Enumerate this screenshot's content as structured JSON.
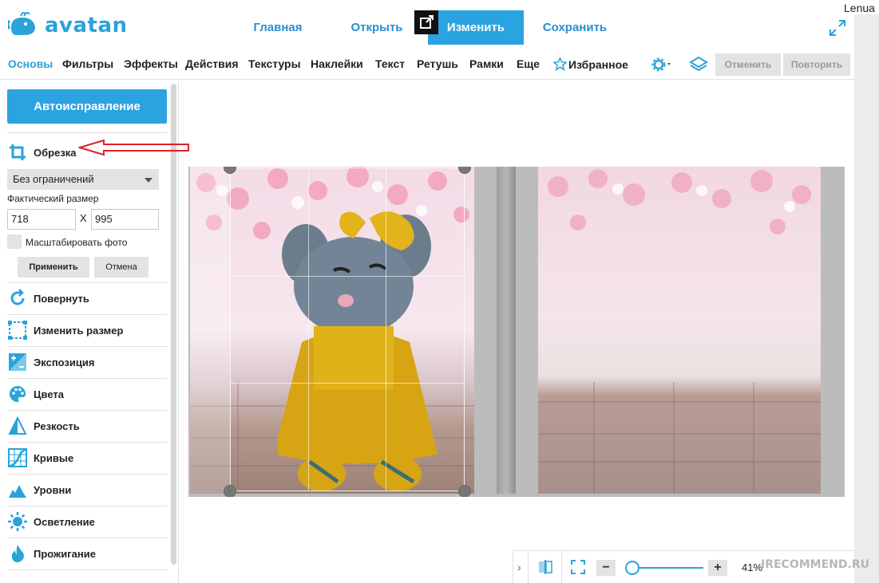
{
  "app": {
    "logo_text": "avatan",
    "user": "Lenua"
  },
  "topnav": {
    "home": "Главная",
    "open": "Открыть",
    "edit": "Изменить",
    "save": "Сохранить"
  },
  "tabs": {
    "items": [
      "Основы",
      "Фильтры",
      "Эффекты",
      "Действия",
      "Текстуры",
      "Наклейки",
      "Текст",
      "Ретушь",
      "Рамки",
      "Еще",
      "Избранное"
    ],
    "active": "Основы",
    "undo": "Отменить",
    "redo": "Повторить"
  },
  "sidebar": {
    "autofix": "Автоисправление",
    "crop": {
      "label": "Обрезка",
      "constraint": "Без ограничений",
      "actual_size_label": "Фактический размер",
      "width": "718",
      "height": "995",
      "separator": "X",
      "scale_label": "Масштабировать фото",
      "scale_checked": false,
      "apply": "Применить",
      "cancel": "Отмена"
    },
    "tools": [
      {
        "label": "Повернуть",
        "icon": "rotate-icon"
      },
      {
        "label": "Изменить размер",
        "icon": "resize-icon"
      },
      {
        "label": "Экспозиция",
        "icon": "exposure-icon"
      },
      {
        "label": "Цвета",
        "icon": "palette-icon"
      },
      {
        "label": "Резкость",
        "icon": "sharpness-icon"
      },
      {
        "label": "Кривые",
        "icon": "curves-icon"
      },
      {
        "label": "Уровни",
        "icon": "levels-icon"
      },
      {
        "label": "Осветление",
        "icon": "brighten-icon"
      },
      {
        "label": "Прожигание",
        "icon": "burn-icon"
      }
    ]
  },
  "zoom": {
    "percent": "41%",
    "level": 0.41
  },
  "watermark": "IRECOMMEND.RU",
  "colors": {
    "accent": "#2aa3e0",
    "brand": "#2aa3d8",
    "button_gray": "#e3e3e3",
    "annotation_arrow": "#d9232a"
  }
}
